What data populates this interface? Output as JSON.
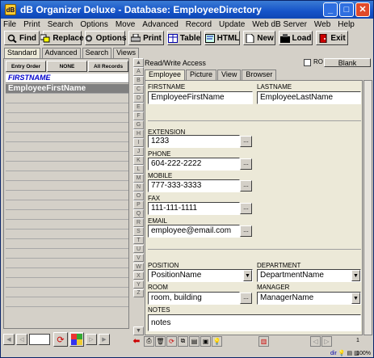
{
  "window": {
    "title": "dB Organizer Deluxe - Database: EmployeeDirectory"
  },
  "menu": [
    "File",
    "Print",
    "Search",
    "Options",
    "Move",
    "Advanced",
    "Record",
    "Update",
    "Web dB Server",
    "Web",
    "Help"
  ],
  "toolbar": {
    "find": "Find",
    "replace": "Replace",
    "options": "Options",
    "print": "Print",
    "table": "Table",
    "html": "HTML",
    "new": "New",
    "load": "Load",
    "exit": "Exit"
  },
  "subtabs": [
    "Standard",
    "Advanced",
    "Search",
    "Views"
  ],
  "list": {
    "entry_order": "Entry Order",
    "none": "NONE",
    "all_records": "All Records",
    "header": "FIRSTNAME",
    "selected_row": "EmployeeFirstName"
  },
  "letters": [
    "A",
    "B",
    "C",
    "D",
    "E",
    "F",
    "G",
    "H",
    "I",
    "J",
    "K",
    "L",
    "M",
    "N",
    "O",
    "P",
    "Q",
    "R",
    "S",
    "T",
    "U",
    "V",
    "W",
    "X",
    "Y",
    "Z"
  ],
  "form": {
    "access": "Read/Write Access",
    "ro_label": "RO",
    "blank_button": "Blank",
    "tabs": [
      "Employee",
      "Picture",
      "View",
      "Browser"
    ],
    "firstname_label": "FIRSTNAME",
    "firstname_value": "EmployeeFirstName",
    "lastname_label": "LASTNAME",
    "lastname_value": "EmployeeLastName",
    "extension_label": "EXTENSION",
    "extension_value": "1233",
    "phone_label": "PHONE",
    "phone_value": "604-222-2222",
    "mobile_label": "MOBILE",
    "mobile_value": "777-333-3333",
    "fax_label": "FAX",
    "fax_value": "111-111-1111",
    "email_label": "EMAIL",
    "email_value": "employee@email.com",
    "position_label": "POSITION",
    "position_value": "PositionName",
    "department_label": "DEPARTMENT",
    "department_value": "DepartmentName",
    "room_label": "ROOM",
    "room_value": "room, building",
    "manager_label": "MANAGER",
    "manager_value": "ManagerName",
    "notes_label": "NOTES",
    "notes_value": "notes",
    "dots": "..."
  },
  "status": {
    "record_index": "1",
    "zoom": "100%",
    "dir": "dir"
  }
}
